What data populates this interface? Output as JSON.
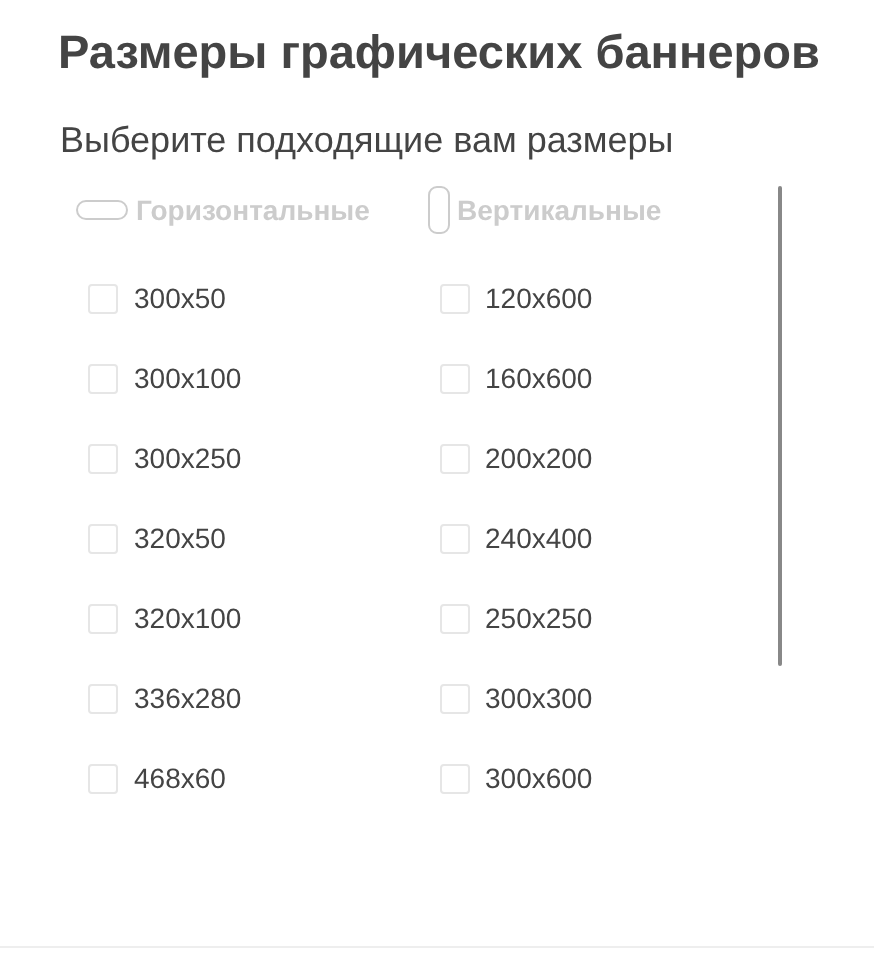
{
  "title": "Размеры графических баннеров",
  "subtitle": "Выберите подходящие вам размеры",
  "columns": [
    {
      "kind": "horizontal",
      "heading": "Горизонтальные",
      "options": [
        {
          "label": "300x50",
          "checked": false
        },
        {
          "label": "300x100",
          "checked": false
        },
        {
          "label": "300x250",
          "checked": false
        },
        {
          "label": "320x50",
          "checked": false
        },
        {
          "label": "320x100",
          "checked": false
        },
        {
          "label": "336x280",
          "checked": false
        },
        {
          "label": "468x60",
          "checked": false
        }
      ]
    },
    {
      "kind": "vertical",
      "heading": "Вертикальные",
      "options": [
        {
          "label": "120x600",
          "checked": false
        },
        {
          "label": "160x600",
          "checked": false
        },
        {
          "label": "200x200",
          "checked": false
        },
        {
          "label": "240x400",
          "checked": false
        },
        {
          "label": "250x250",
          "checked": false
        },
        {
          "label": "300x300",
          "checked": false
        },
        {
          "label": "300x600",
          "checked": false
        }
      ]
    }
  ]
}
